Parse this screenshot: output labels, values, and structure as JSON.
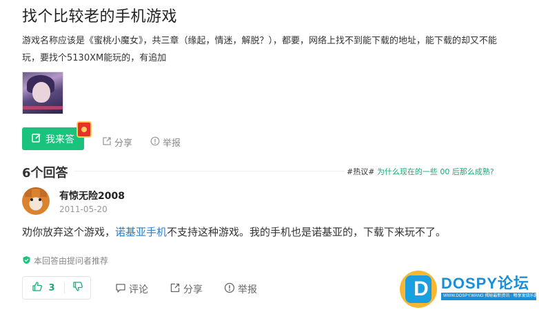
{
  "question": {
    "title": "找个比较老的手机游戏",
    "description": "游戏名称应该是《蜜桃小魔女》，共三章（缘起，情迷，解脱？），都要，网络上找不到能下载的地址，能下载的却又不能玩，要找个5130XM能玩的，有追加"
  },
  "actions": {
    "answer_label": "我来答",
    "share_label": "分享",
    "report_label": "举报"
  },
  "answers_header": {
    "count_label": "6个回答",
    "hot_tag": "#热议#",
    "hot_link": "为什么现在的一些 00 后那么成熟?"
  },
  "answer": {
    "user_name": "有惊无险2008",
    "date": "2011-05-20",
    "text_before": "劝你放弃这个游戏，",
    "text_link": "诺基亚手机",
    "text_after": "不支持这种游戏。我的手机也是诺基亚的，下载下来玩不了。",
    "recommend_label": "本回答由提问者推荐",
    "like_count": "3",
    "comment_label": "评论",
    "share_label": "分享",
    "report_label": "举报"
  },
  "watermark": {
    "letter": "D",
    "brand": "DOSPY",
    "brand_cn": "论坛",
    "strip_text": "WWW.DOSPY.WANG 揭秘最新资讯 · 畅享发烧乐趣"
  },
  "colors": {
    "accent_green": "#19c37d",
    "link_blue": "#2e7dc9",
    "hot_link_green": "#19a974"
  }
}
